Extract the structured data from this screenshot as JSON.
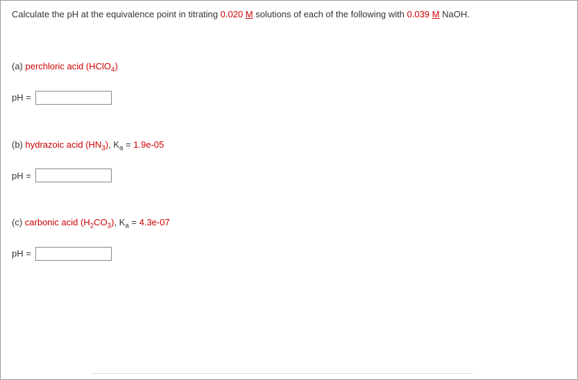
{
  "question": {
    "prefix": "Calculate the pH at the equivalence point in titrating ",
    "conc1": "0.020 ",
    "molar1": "M",
    "middle": " solutions of each of the following with ",
    "conc2": "0.039 ",
    "molar2": "M",
    "suffix": " NaOH."
  },
  "parts": {
    "a": {
      "label": "(a) ",
      "acid": "perchloric acid (HClO",
      "sub": "4",
      "close": ")",
      "ph_label": "pH = "
    },
    "b": {
      "label": "(b) ",
      "acid": "hydrazoic acid (HN",
      "sub": "3",
      "close": ")",
      "ka_text": ", K",
      "ka_sub": "a",
      "ka_eq": " = ",
      "ka_val": "1.9e-05",
      "ph_label": "pH = "
    },
    "c": {
      "label": "(c) ",
      "acid": "carbonic acid (H",
      "sub1": "2",
      "mid": "CO",
      "sub2": "3",
      "close": ")",
      "ka_text": ", K",
      "ka_sub": "a",
      "ka_eq": " = ",
      "ka_val": "4.3e-07",
      "ph_label": "pH = "
    }
  }
}
